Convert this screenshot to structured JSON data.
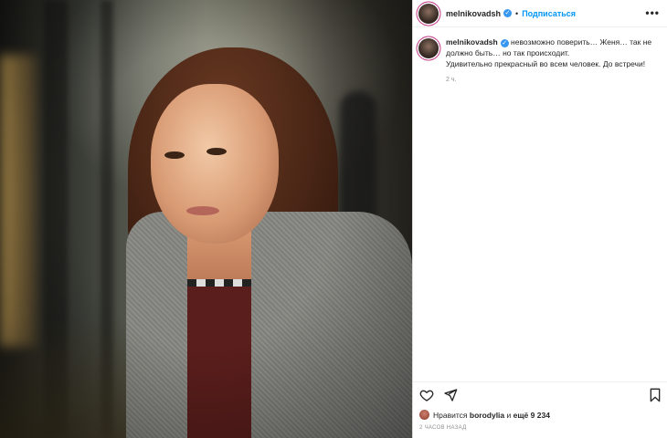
{
  "header": {
    "username": "melnikovadsh",
    "separator": "•",
    "follow_label": "Подписаться",
    "more_label": "•••"
  },
  "caption": {
    "username": "melnikovadsh",
    "line1": " невозможно поверить… Женя… так не должно быть… но так происходит.",
    "line2": "Удивительно прекрасный во всем человек. До встречи!",
    "time": "2 ч."
  },
  "actions": {
    "like_icon": "heart-icon",
    "share_icon": "send-icon",
    "save_icon": "bookmark-icon"
  },
  "likes": {
    "prefix": "Нравится",
    "user": "borodylia",
    "middle": "и",
    "rest": "ещё 9 234"
  },
  "posted_ago": "2 ЧАСОВ НАЗАД",
  "colors": {
    "accent": "#0095f6",
    "verified": "#3897f0",
    "muted": "#8e8e8e",
    "text": "#262626"
  }
}
